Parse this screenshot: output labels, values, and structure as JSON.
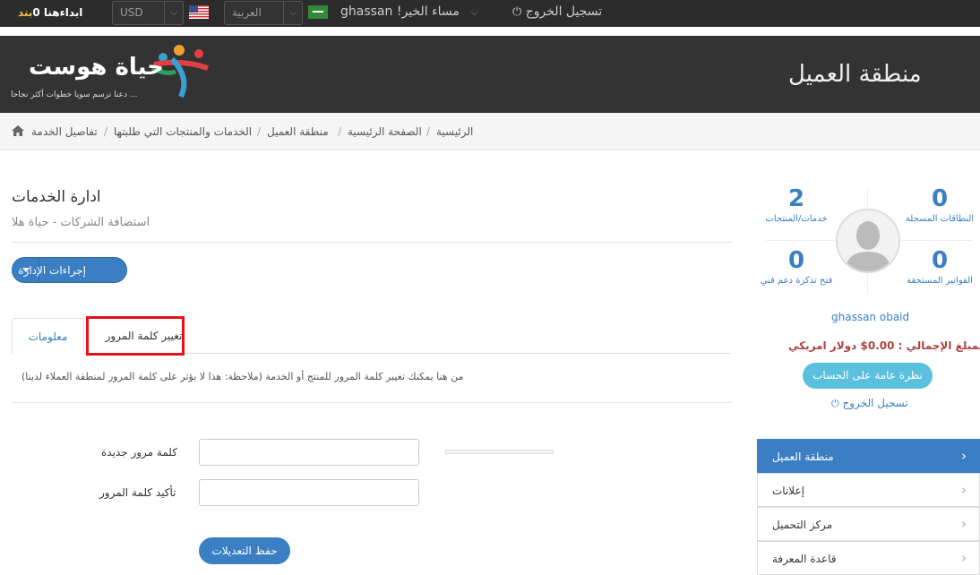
{
  "topbar": {
    "cart_label": "ابداءهنا 0",
    "brand": "بند",
    "currency": "USD",
    "language": "العربية",
    "greeting": "ghassan !مساء الخير",
    "logout": "تسجيل الخروج"
  },
  "header": {
    "page_title": "منطقة العميل",
    "logo_text": "حياة هوست",
    "logo_tagline": "دعنا نرسم سويا خطوات أكثر نجاحا ..."
  },
  "breadcrumb": [
    "الرئيسية",
    "الصفحة الرئيسية",
    "منطقة العميل",
    "الخدمات والمنتجات التي طلبتها",
    "تفاصيل الخدمة"
  ],
  "main": {
    "title": "ادارة الخدمات",
    "subtitle": "استضافة الشركات - حياة هلا",
    "actions_button": "إجراءات الإدارة",
    "tabs": [
      {
        "label": "معلومات"
      },
      {
        "label": "تغيير كلمة المرور"
      }
    ],
    "note": "(من هنا يمكنك تغيير كلمة المرور للمنتج أو الخدمة (ملاحظة: هذا لا يؤثر على كلمة المرور لمنطقة العملاء لدينا",
    "new_password_label": "كلمة مرور جديدة",
    "confirm_password_label": "تأكيد كلمة المرور",
    "save_button": "حفظ التعديلات"
  },
  "sidebar": {
    "stats": [
      {
        "num": "0",
        "label": "النطاقات المسجلة"
      },
      {
        "num": "2",
        "label": "خدمات/المنتجات"
      },
      {
        "num": "0",
        "label": "الفواتير المستحقة"
      },
      {
        "num": "0",
        "label": "فتح تذكرة دعم فني"
      }
    ],
    "user_name": "ghassan obaid",
    "total": "المبلغ الإجمالي : 0.00$ دولار امريكي",
    "overview_button": "نظرة عامة على الحساب",
    "logout": "تسجيل الخروج",
    "menu": [
      {
        "label": "منطقة العميل"
      },
      {
        "label": "إعلانات"
      },
      {
        "label": "مركز التحميل"
      },
      {
        "label": "قاعدة المعرفة"
      }
    ]
  },
  "colors": {
    "accent": "#3a7fc3",
    "highlight": "#e3101d",
    "info": "#5bc0de"
  }
}
